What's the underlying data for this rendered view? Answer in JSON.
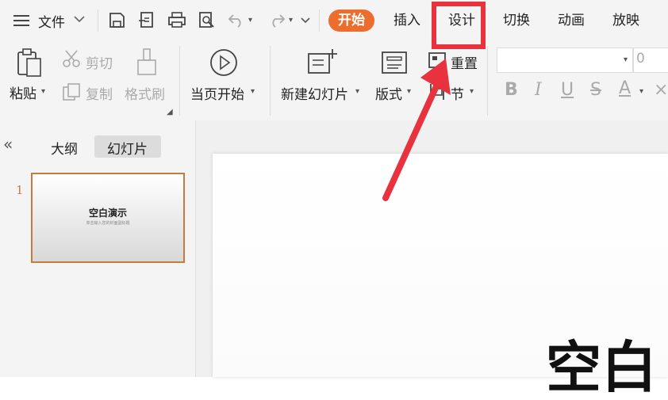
{
  "menu": {
    "file_label": "文件"
  },
  "tabs": [
    {
      "label": "开始"
    },
    {
      "label": "插入"
    },
    {
      "label": "设计"
    },
    {
      "label": "切换"
    },
    {
      "label": "动画"
    },
    {
      "label": "放映"
    }
  ],
  "ribbon": {
    "paste": "粘贴",
    "cut": "剪切",
    "copy": "复制",
    "format_painter": "格式刷",
    "play_from_current": "当页开始",
    "new_slide": "新建幻灯片",
    "layout": "版式",
    "reset": "重置",
    "section": "节",
    "font_size_value": "0"
  },
  "panel": {
    "tab_outline": "大纲",
    "tab_slides": "幻灯片",
    "slide_number": "1",
    "thumb_title": "空白演示",
    "thumb_subtitle": "单击输入您的封面副标题"
  },
  "slide": {
    "title": "空白"
  },
  "colors": {
    "accent": "#ec6d2d",
    "highlight": "#e8333f",
    "thumb_border": "#c87a3e"
  }
}
